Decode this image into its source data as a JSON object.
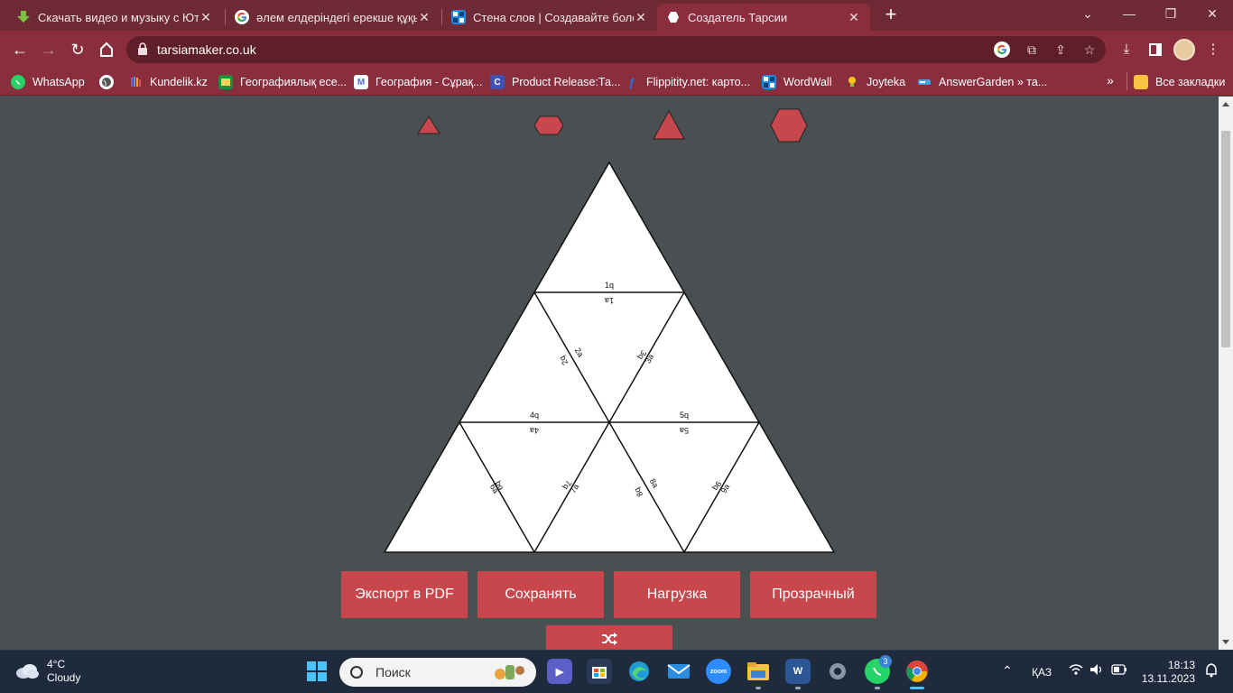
{
  "browser": {
    "tabs": [
      {
        "title": "Скачать видео и музыку с Ютуб",
        "icon": "download-icon",
        "color": "#7cc242"
      },
      {
        "title": "әлем елдеріндегі ерекше құқық",
        "icon": "google-icon",
        "color": "#ffffff"
      },
      {
        "title": "Стена слов | Создавайте более",
        "icon": "wordwall-icon",
        "color": "#1e88e5"
      },
      {
        "title": "Создатель Тарсии",
        "icon": "hexagon-icon",
        "color": "#ffffff"
      }
    ],
    "url": "tarsiamaker.co.uk",
    "bookmarks": [
      {
        "label": "WhatsApp",
        "icon": "whatsapp-icon",
        "color": "#25d366"
      },
      {
        "label": "",
        "icon": "globe-icon",
        "color": "#ffffff"
      },
      {
        "label": "Kundelik.kz",
        "icon": "hand-icon",
        "color": "#7b5cd6"
      },
      {
        "label": "Географиялық есе...",
        "icon": "classroom-icon",
        "color": "#1e8e3e"
      },
      {
        "label": "География - Сұрақ...",
        "icon": "m-icon",
        "color": "#4b6fd6"
      },
      {
        "label": "Product Release:Та...",
        "icon": "c-icon",
        "color": "#3f51b5"
      },
      {
        "label": "Flippitity.net: карто...",
        "icon": "flippity-icon",
        "color": "#2a6fd6"
      },
      {
        "label": "WordWall",
        "icon": "wordwall-icon",
        "color": "#1e88e5"
      },
      {
        "label": "Joyteka",
        "icon": "bulb-icon",
        "color": "#f5c518"
      },
      {
        "label": "AnswerGarden » та...",
        "icon": "answergarden-icon",
        "color": "#4aa3df"
      }
    ],
    "all_bookmarks": "Все закладки"
  },
  "page": {
    "buttons": {
      "export_pdf": "Экспорт в PDF",
      "save": "Сохранять",
      "load": "Нагрузка",
      "transparent": "Прозрачный"
    },
    "shuffle_icon": "shuffle-icon",
    "shape_options": [
      "small-triangle",
      "small-hexagon",
      "large-triangle",
      "large-hexagon"
    ],
    "accent_color": "#c8474d",
    "puzzle_edges": [
      {
        "q": "1q",
        "a": "1a"
      },
      {
        "q": "2q",
        "a": "2a"
      },
      {
        "q": "3q",
        "a": "3a"
      },
      {
        "q": "4q",
        "a": "4a"
      },
      {
        "q": "5q",
        "a": "5a"
      },
      {
        "q": "6q",
        "a": "6a"
      },
      {
        "q": "7q",
        "a": "7a"
      },
      {
        "q": "8q",
        "a": "8a"
      },
      {
        "q": "9q",
        "a": "9a"
      }
    ]
  },
  "taskbar": {
    "weather": {
      "temp": "4°C",
      "condition": "Cloudy"
    },
    "search_placeholder": "Поиск",
    "whatsapp_badge": "3",
    "language": "ҚАЗ",
    "time": "18:13",
    "date": "13.11.2023"
  }
}
